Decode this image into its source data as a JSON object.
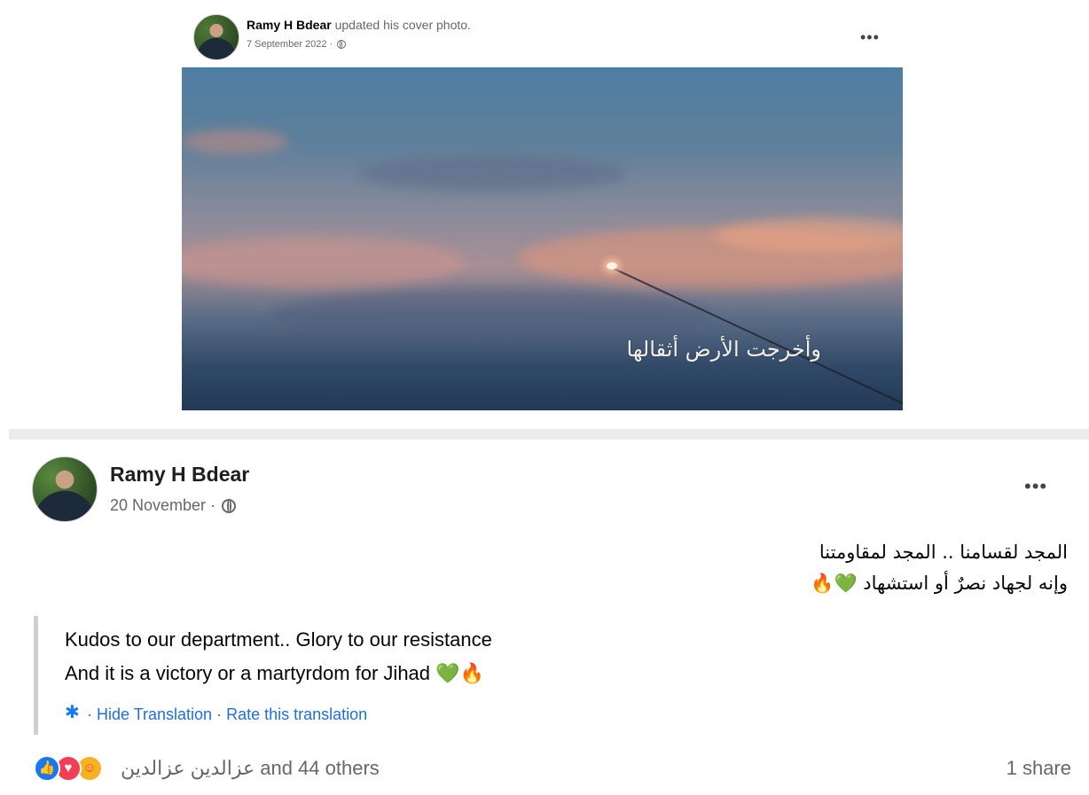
{
  "post1": {
    "author": "Ramy H Bdear",
    "action": "updated his cover photo.",
    "date": "7 September 2022",
    "more": "•••",
    "photo_caption": "وأخرجت الأرض أثقالها"
  },
  "post2": {
    "author": "Ramy H Bdear",
    "date": "20 November",
    "more": "•••",
    "arabic_line1": "المجد لقسامنا .. المجد لمقاومتنا",
    "arabic_line2": "وإنه لجهاد نصرٌ أو استشهاد 💚🔥",
    "translation_line1": "Kudos to our department.. Glory to our resistance",
    "translation_line2": "And it is a victory or a martyrdom for Jihad 💚🔥",
    "hide_translation": "Hide Translation",
    "rate_translation": "Rate this translation",
    "reactors": "عزالدين عزالدين and 44 others",
    "shares": "1 share"
  },
  "icons": {
    "like": "like-icon",
    "love": "love-icon",
    "care": "care-icon",
    "globe": "globe-icon",
    "gear": "gear-icon"
  },
  "colors": {
    "link": "#216fdb",
    "like": "#1877f2",
    "love": "#f33e58",
    "care": "#f7b125",
    "meta": "#65676b"
  }
}
